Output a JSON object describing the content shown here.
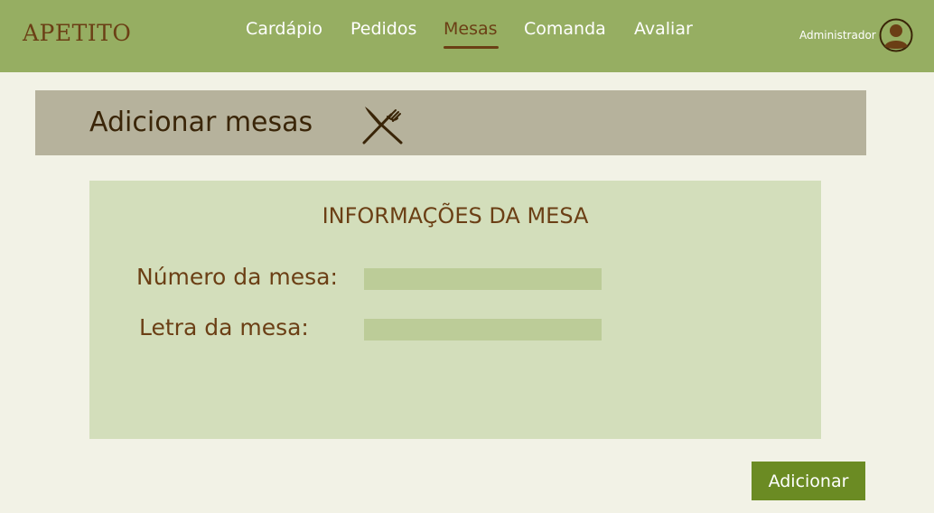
{
  "header": {
    "logo": "APETITO",
    "nav": [
      {
        "label": "Cardápio",
        "active": false
      },
      {
        "label": "Pedidos",
        "active": false
      },
      {
        "label": "Mesas",
        "active": true
      },
      {
        "label": "Comanda",
        "active": false
      },
      {
        "label": "Avaliar",
        "active": false
      }
    ],
    "user_label": "Administrador",
    "user_icon": "user-avatar-icon"
  },
  "page": {
    "title": "Adicionar mesas",
    "title_icon": "fork-knife-icon"
  },
  "form": {
    "heading": "INFORMAÇÕES DA MESA",
    "fields": [
      {
        "label": "Número da mesa:",
        "value": ""
      },
      {
        "label": "Letra da mesa:",
        "value": ""
      }
    ],
    "submit_label": "Adicionar"
  },
  "colors": {
    "header_bg": "#96ae62",
    "brand_brown": "#6b3f15",
    "title_bar_bg": "#b6b29c",
    "panel_bg": "#d3debb",
    "input_bg": "#bccc98",
    "button_bg": "#6b8b23",
    "page_bg": "#f2f2e6"
  }
}
